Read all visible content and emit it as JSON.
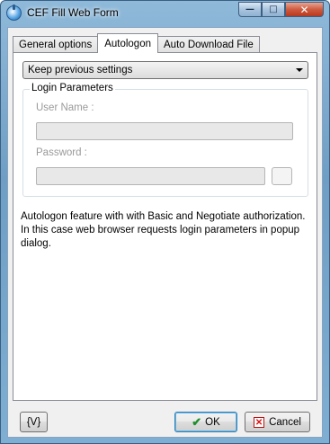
{
  "window": {
    "title": "CEF Fill Web Form"
  },
  "caption_buttons": {
    "minimize": "—",
    "maximize": "□",
    "close": "✕"
  },
  "tabs": [
    {
      "label": "General options",
      "active": false
    },
    {
      "label": "Autologon",
      "active": true
    },
    {
      "label": "Auto Download File",
      "active": false
    }
  ],
  "autologon": {
    "mode_value": "Keep previous settings",
    "group_title": "Login Parameters",
    "username_label": "User Name :",
    "username_value": "",
    "password_label": "Password :",
    "password_value": "",
    "description": "Autologon feature with with Basic and Negotiate authorization. In this case web browser requests login parameters in popup dialog."
  },
  "footer": {
    "variables_label": "{V}",
    "ok_label": "OK",
    "cancel_label": "Cancel"
  },
  "icons": {
    "app": "cef-fill-web-form-icon",
    "ok": "checkmark-icon",
    "cancel": "red-x-icon"
  },
  "colors": {
    "titlebar": "#7eaed2",
    "ok_icon": "#1f8f2c",
    "cancel_icon": "#dd1111"
  }
}
